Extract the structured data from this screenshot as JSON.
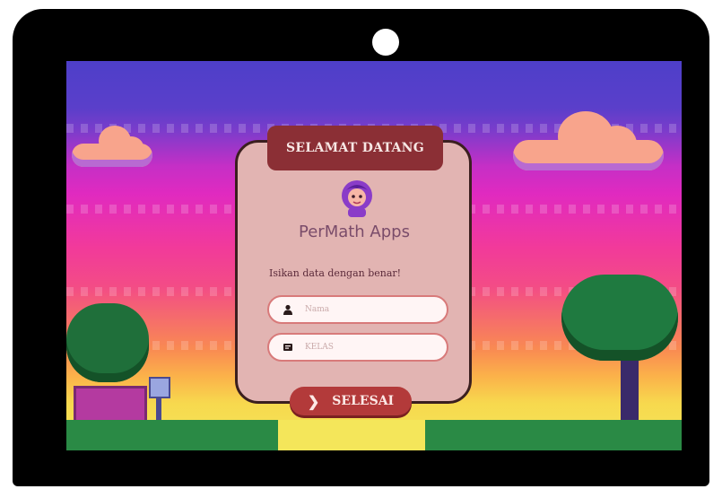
{
  "header": {
    "title": "SELAMAT DATANG"
  },
  "app": {
    "name": "PerMath Apps"
  },
  "form": {
    "instruction": "Isikan data dengan benar!",
    "name_placeholder": "Nama",
    "class_placeholder": "KELAS",
    "submit_label": "SELESAI"
  },
  "icons": {
    "name_field": "user-icon",
    "class_field": "id-card-icon",
    "submit": "chevron-right-icon"
  },
  "colors": {
    "card": "#e2b4b2",
    "header": "#8b2f35",
    "button": "#b33a3a"
  }
}
